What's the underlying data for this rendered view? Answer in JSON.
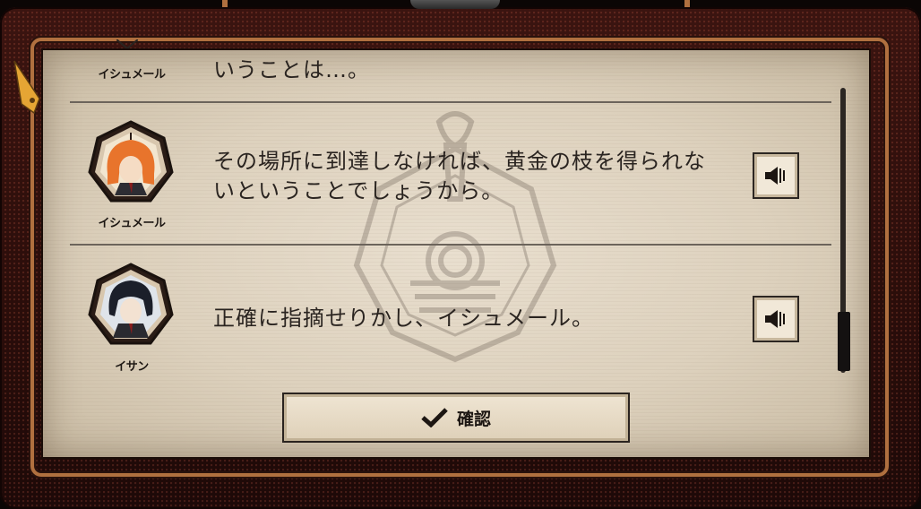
{
  "log": {
    "entries": [
      {
        "speaker": "イシュメール",
        "text_lines": [
          "いうことは…。"
        ],
        "has_voice": false,
        "portrait": "ishmael-portrait"
      },
      {
        "speaker": "イシュメール",
        "text_lines": [
          "その場所に到達しなければ、黄金の枝を得られな",
          "いということでしょうから。"
        ],
        "has_voice": true,
        "portrait": "ishmael-portrait"
      },
      {
        "speaker": "イサン",
        "text_lines": [
          "正確に指摘せりかし、イシュメール。"
        ],
        "has_voice": true,
        "portrait": "yi-sang-portrait"
      }
    ]
  },
  "confirm_button": {
    "label": "確認",
    "icon": "checkmark-icon"
  },
  "colors": {
    "frame": "#2a0d0a",
    "copper": "#b0703f",
    "paper": "#e2d7c5",
    "ink": "#2a2420",
    "ishmael_hair": "#e8742c",
    "yi_sang_hair": "#1b1f2a"
  },
  "icons": [
    "pen-nib-icon",
    "speaker-icon",
    "checkmark-icon",
    "watermark-emblem"
  ]
}
